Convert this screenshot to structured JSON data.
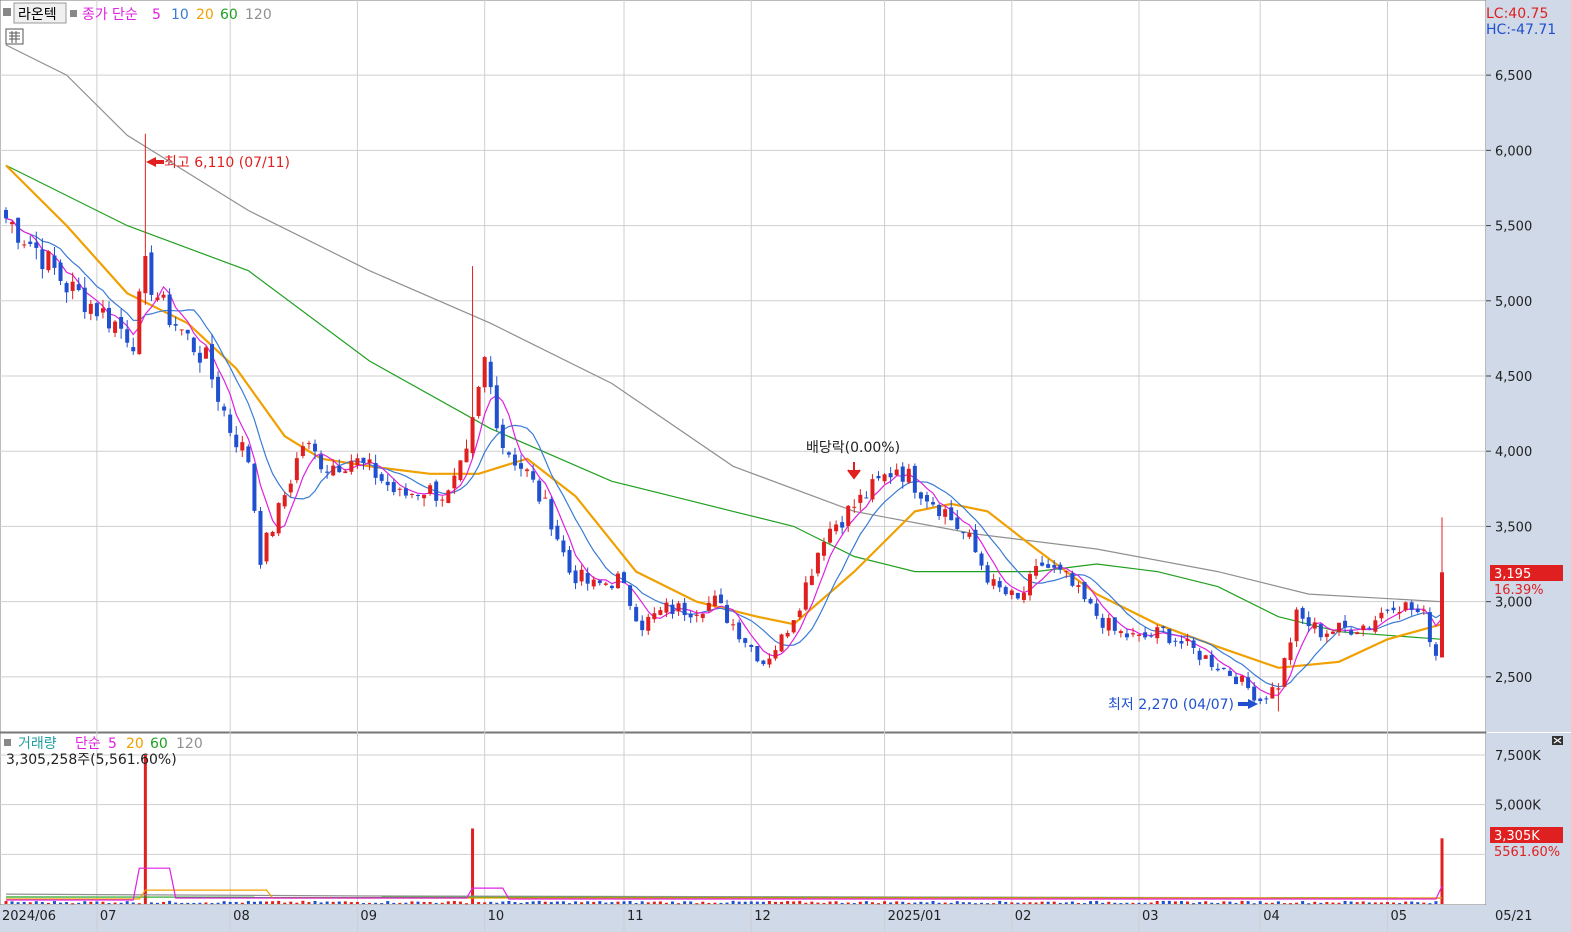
{
  "header": {
    "ticker": "라온텍",
    "price_label": "종가",
    "ma_type": "단순",
    "ma_periods": [
      "5",
      "10",
      "20",
      "60",
      "120"
    ],
    "lc": "LC:40.75",
    "hc": "HC:-47.71"
  },
  "volume_header": {
    "label": "거래량",
    "ma_type": "단순",
    "ma_periods": [
      "5",
      "20",
      "60",
      "120"
    ],
    "value_text": "3,305,258주(5,561.60%)"
  },
  "annotations": {
    "high": "최고 6,110 (07/11)",
    "low": "최저 2,270 (04/07)",
    "dividend": "배당락(0.00%)"
  },
  "price_badge": {
    "price": "3,195",
    "change": "16.39%"
  },
  "volume_badge": {
    "value": "3,305K",
    "ratio": "5561.60%"
  },
  "colors": {
    "up": "#e02020",
    "down": "#2050d0",
    "ma5": "#e020e0",
    "ma10": "#3a7bd5",
    "ma20": "#f0a000",
    "ma60": "#20a020",
    "ma120": "#909090"
  },
  "chart_data": {
    "type": "candlestick",
    "price_axis": {
      "ylim": [
        2200,
        6800
      ],
      "ticks": [
        "2,500",
        "3,000",
        "3,500",
        "4,000",
        "4,500",
        "5,000",
        "5,500",
        "6,000",
        "6,500"
      ]
    },
    "volume_axis": {
      "ylim": [
        0,
        8000
      ],
      "ticks": [
        "5,000K",
        "7,500K"
      ]
    },
    "x_labels": [
      "2024/06",
      "07",
      "08",
      "09",
      "10",
      "11",
      "12",
      "2025/01",
      "02",
      "03",
      "04",
      "05",
      "05/21"
    ],
    "close_path": [
      [
        0,
        5550
      ],
      [
        5,
        5350
      ],
      [
        10,
        5100
      ],
      [
        15,
        4950
      ],
      [
        18,
        4850
      ],
      [
        21,
        4750
      ],
      [
        23,
        5200
      ],
      [
        26,
        4950
      ],
      [
        29,
        4800
      ],
      [
        33,
        4600
      ],
      [
        37,
        4150
      ],
      [
        40,
        3950
      ],
      [
        42,
        3300
      ],
      [
        45,
        3600
      ],
      [
        49,
        4050
      ],
      [
        53,
        3900
      ],
      [
        57,
        3950
      ],
      [
        61,
        3850
      ],
      [
        65,
        3700
      ],
      [
        69,
        3750
      ],
      [
        73,
        3700
      ],
      [
        76,
        3950
      ],
      [
        79,
        4600
      ],
      [
        82,
        4050
      ],
      [
        86,
        3850
      ],
      [
        90,
        3550
      ],
      [
        93,
        3200
      ],
      [
        97,
        3100
      ],
      [
        101,
        3150
      ],
      [
        105,
        2850
      ],
      [
        109,
        2950
      ],
      [
        113,
        2950
      ],
      [
        117,
        3000
      ],
      [
        121,
        2800
      ],
      [
        125,
        2600
      ],
      [
        128,
        2750
      ],
      [
        131,
        3000
      ],
      [
        135,
        3450
      ],
      [
        139,
        3600
      ],
      [
        143,
        3750
      ],
      [
        147,
        3900
      ],
      [
        151,
        3750
      ],
      [
        155,
        3600
      ],
      [
        159,
        3400
      ],
      [
        163,
        3100
      ],
      [
        167,
        3000
      ],
      [
        171,
        3250
      ],
      [
        175,
        3150
      ],
      [
        179,
        2950
      ],
      [
        183,
        2800
      ],
      [
        187,
        2750
      ],
      [
        191,
        2800
      ],
      [
        195,
        2700
      ],
      [
        199,
        2600
      ],
      [
        203,
        2500
      ],
      [
        207,
        2350
      ],
      [
        210,
        2450
      ],
      [
        213,
        2900
      ],
      [
        217,
        2800
      ],
      [
        221,
        2820
      ],
      [
        225,
        2850
      ],
      [
        229,
        3000
      ],
      [
        232,
        2950
      ],
      [
        234,
        2900
      ],
      [
        236,
        2650
      ],
      [
        237,
        3195
      ]
    ],
    "ma20_path": [
      [
        0,
        5900
      ],
      [
        10,
        5500
      ],
      [
        20,
        5050
      ],
      [
        30,
        4850
      ],
      [
        38,
        4550
      ],
      [
        46,
        4100
      ],
      [
        52,
        3950
      ],
      [
        60,
        3900
      ],
      [
        70,
        3850
      ],
      [
        78,
        3850
      ],
      [
        86,
        3950
      ],
      [
        94,
        3700
      ],
      [
        104,
        3200
      ],
      [
        114,
        3000
      ],
      [
        124,
        2900
      ],
      [
        130,
        2850
      ],
      [
        140,
        3200
      ],
      [
        150,
        3600
      ],
      [
        156,
        3650
      ],
      [
        162,
        3600
      ],
      [
        170,
        3350
      ],
      [
        180,
        3050
      ],
      [
        190,
        2850
      ],
      [
        200,
        2700
      ],
      [
        210,
        2560
      ],
      [
        220,
        2600
      ],
      [
        228,
        2750
      ],
      [
        237,
        2850
      ]
    ],
    "ma60_path": [
      [
        0,
        5900
      ],
      [
        20,
        5500
      ],
      [
        40,
        5200
      ],
      [
        60,
        4600
      ],
      [
        80,
        4150
      ],
      [
        100,
        3800
      ],
      [
        110,
        3700
      ],
      [
        120,
        3600
      ],
      [
        130,
        3500
      ],
      [
        140,
        3300
      ],
      [
        150,
        3200
      ],
      [
        160,
        3200
      ],
      [
        170,
        3200
      ],
      [
        180,
        3250
      ],
      [
        190,
        3200
      ],
      [
        200,
        3100
      ],
      [
        210,
        2900
      ],
      [
        220,
        2800
      ],
      [
        237,
        2750
      ]
    ],
    "ma120_path": [
      [
        0,
        6700
      ],
      [
        10,
        6500
      ],
      [
        20,
        6100
      ],
      [
        40,
        5600
      ],
      [
        60,
        5200
      ],
      [
        80,
        4850
      ],
      [
        100,
        4450
      ],
      [
        120,
        3900
      ],
      [
        140,
        3600
      ],
      [
        160,
        3450
      ],
      [
        180,
        3350
      ],
      [
        200,
        3200
      ],
      [
        215,
        3050
      ],
      [
        237,
        3000
      ]
    ],
    "volume_spikes": [
      [
        23,
        7500
      ],
      [
        77,
        3800
      ],
      [
        237,
        3305
      ]
    ],
    "volume_ma5_path": [
      [
        0,
        200
      ],
      [
        21,
        200
      ],
      [
        22,
        1800
      ],
      [
        27,
        1800
      ],
      [
        28,
        300
      ],
      [
        76,
        300
      ],
      [
        77,
        800
      ],
      [
        82,
        800
      ],
      [
        83,
        250
      ],
      [
        236,
        250
      ],
      [
        237,
        900
      ]
    ],
    "volume_ma20_path": [
      [
        0,
        250
      ],
      [
        22,
        250
      ],
      [
        23,
        700
      ],
      [
        43,
        700
      ],
      [
        44,
        300
      ],
      [
        237,
        300
      ]
    ],
    "volume_ma60_path": [
      [
        0,
        350
      ],
      [
        237,
        300
      ]
    ],
    "volume_ma120_path": [
      [
        0,
        500
      ],
      [
        60,
        400
      ],
      [
        237,
        300
      ]
    ]
  }
}
